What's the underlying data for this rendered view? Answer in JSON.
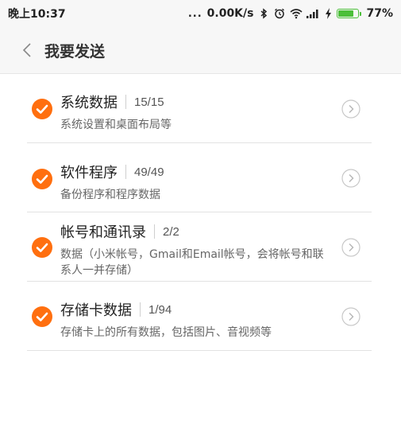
{
  "statusbar": {
    "time": "晚上10:37",
    "dots": "...",
    "speed": "0.00K/s",
    "battery_pct": "77%",
    "battery_level": 0.77,
    "icons": [
      "bluetooth-icon",
      "alarm-icon",
      "wifi-icon",
      "signal-icon",
      "charging-icon",
      "battery-icon"
    ]
  },
  "header": {
    "back_icon": "chevron-left-icon",
    "title": "我要发送"
  },
  "colors": {
    "accent": "#ff6f0f",
    "battery": "#4cbf3a"
  },
  "items": [
    {
      "title": "系统数据",
      "count": "15/15",
      "desc": "系统设置和桌面布局等"
    },
    {
      "title": "软件程序",
      "count": "49/49",
      "desc": "备份程序和程序数据"
    },
    {
      "title": "帐号和通讯录",
      "count": "2/2",
      "desc": "数据（小米帐号，Gmail和Email帐号，会将帐号和联系人一并存储）"
    },
    {
      "title": "存储卡数据",
      "count": "1/94",
      "desc": "存储卡上的所有数据，包括图片、音视频等"
    }
  ]
}
